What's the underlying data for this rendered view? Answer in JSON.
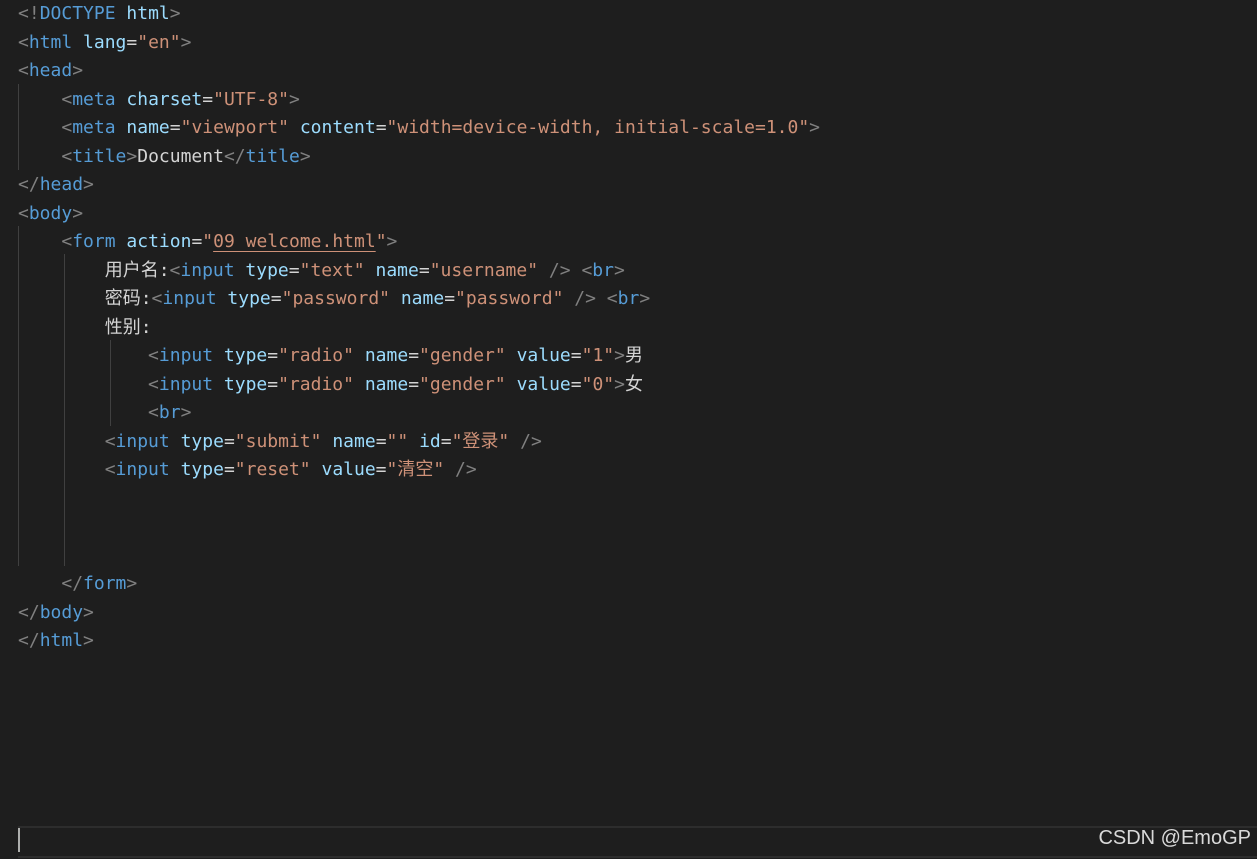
{
  "colors": {
    "background": "#1e1e1e",
    "punctuation": "#808080",
    "tag": "#569cd6",
    "attribute": "#9cdcfe",
    "string": "#ce9178",
    "text": "#d4d4d4"
  },
  "code_lines": [
    [
      [
        "punct",
        "<!"
      ],
      [
        "tag",
        "DOCTYPE"
      ],
      [
        "text",
        " "
      ],
      [
        "attr",
        "html"
      ],
      [
        "punct",
        ">"
      ]
    ],
    [
      [
        "punct",
        "<"
      ],
      [
        "tag",
        "html"
      ],
      [
        "text",
        " "
      ],
      [
        "attr",
        "lang"
      ],
      [
        "text",
        "="
      ],
      [
        "str",
        "\"en\""
      ],
      [
        "punct",
        ">"
      ]
    ],
    [
      [
        "punct",
        "<"
      ],
      [
        "tag",
        "head"
      ],
      [
        "punct",
        ">"
      ]
    ],
    [
      [
        "text",
        "    "
      ],
      [
        "punct",
        "<"
      ],
      [
        "tag",
        "meta"
      ],
      [
        "text",
        " "
      ],
      [
        "attr",
        "charset"
      ],
      [
        "text",
        "="
      ],
      [
        "str",
        "\"UTF-8\""
      ],
      [
        "punct",
        ">"
      ]
    ],
    [
      [
        "text",
        "    "
      ],
      [
        "punct",
        "<"
      ],
      [
        "tag",
        "meta"
      ],
      [
        "text",
        " "
      ],
      [
        "attr",
        "name"
      ],
      [
        "text",
        "="
      ],
      [
        "str",
        "\"viewport\""
      ],
      [
        "text",
        " "
      ],
      [
        "attr",
        "content"
      ],
      [
        "text",
        "="
      ],
      [
        "str",
        "\"width=device-width, initial-scale=1.0\""
      ],
      [
        "punct",
        ">"
      ]
    ],
    [
      [
        "text",
        "    "
      ],
      [
        "punct",
        "<"
      ],
      [
        "tag",
        "title"
      ],
      [
        "punct",
        ">"
      ],
      [
        "text",
        "Document"
      ],
      [
        "punct",
        "</"
      ],
      [
        "tag",
        "title"
      ],
      [
        "punct",
        ">"
      ]
    ],
    [
      [
        "punct",
        "</"
      ],
      [
        "tag",
        "head"
      ],
      [
        "punct",
        ">"
      ]
    ],
    [
      [
        "punct",
        "<"
      ],
      [
        "tag",
        "body"
      ],
      [
        "punct",
        ">"
      ]
    ],
    [
      [
        "text",
        "    "
      ],
      [
        "punct",
        "<"
      ],
      [
        "tag",
        "form"
      ],
      [
        "text",
        " "
      ],
      [
        "attr",
        "action"
      ],
      [
        "text",
        "="
      ],
      [
        "str",
        "\""
      ],
      [
        "link",
        "09 welcome.html"
      ],
      [
        "str",
        "\""
      ],
      [
        "punct",
        ">"
      ]
    ],
    [
      [
        "text",
        "        用户名:"
      ],
      [
        "punct",
        "<"
      ],
      [
        "tag",
        "input"
      ],
      [
        "text",
        " "
      ],
      [
        "attr",
        "type"
      ],
      [
        "text",
        "="
      ],
      [
        "str",
        "\"text\""
      ],
      [
        "text",
        " "
      ],
      [
        "attr",
        "name"
      ],
      [
        "text",
        "="
      ],
      [
        "str",
        "\"username\""
      ],
      [
        "text",
        " "
      ],
      [
        "punct",
        "/>"
      ],
      [
        "text",
        " "
      ],
      [
        "punct",
        "<"
      ],
      [
        "tag",
        "br"
      ],
      [
        "punct",
        ">"
      ]
    ],
    [
      [
        "text",
        "        密码:"
      ],
      [
        "punct",
        "<"
      ],
      [
        "tag",
        "input"
      ],
      [
        "text",
        " "
      ],
      [
        "attr",
        "type"
      ],
      [
        "text",
        "="
      ],
      [
        "str",
        "\"password\""
      ],
      [
        "text",
        " "
      ],
      [
        "attr",
        "name"
      ],
      [
        "text",
        "="
      ],
      [
        "str",
        "\"password\""
      ],
      [
        "text",
        " "
      ],
      [
        "punct",
        "/>"
      ],
      [
        "text",
        " "
      ],
      [
        "punct",
        "<"
      ],
      [
        "tag",
        "br"
      ],
      [
        "punct",
        ">"
      ]
    ],
    [
      [
        "text",
        "        性别:"
      ]
    ],
    [
      [
        "text",
        "            "
      ],
      [
        "punct",
        "<"
      ],
      [
        "tag",
        "input"
      ],
      [
        "text",
        " "
      ],
      [
        "attr",
        "type"
      ],
      [
        "text",
        "="
      ],
      [
        "str",
        "\"radio\""
      ],
      [
        "text",
        " "
      ],
      [
        "attr",
        "name"
      ],
      [
        "text",
        "="
      ],
      [
        "str",
        "\"gender\""
      ],
      [
        "text",
        " "
      ],
      [
        "attr",
        "value"
      ],
      [
        "text",
        "="
      ],
      [
        "str",
        "\"1\""
      ],
      [
        "punct",
        ">"
      ],
      [
        "text",
        "男"
      ]
    ],
    [
      [
        "text",
        "            "
      ],
      [
        "punct",
        "<"
      ],
      [
        "tag",
        "input"
      ],
      [
        "text",
        " "
      ],
      [
        "attr",
        "type"
      ],
      [
        "text",
        "="
      ],
      [
        "str",
        "\"radio\""
      ],
      [
        "text",
        " "
      ],
      [
        "attr",
        "name"
      ],
      [
        "text",
        "="
      ],
      [
        "str",
        "\"gender\""
      ],
      [
        "text",
        " "
      ],
      [
        "attr",
        "value"
      ],
      [
        "text",
        "="
      ],
      [
        "str",
        "\"0\""
      ],
      [
        "punct",
        ">"
      ],
      [
        "text",
        "女"
      ]
    ],
    [
      [
        "text",
        "            "
      ],
      [
        "punct",
        "<"
      ],
      [
        "tag",
        "br"
      ],
      [
        "punct",
        ">"
      ]
    ],
    [
      [
        "text",
        "        "
      ],
      [
        "punct",
        "<"
      ],
      [
        "tag",
        "input"
      ],
      [
        "text",
        " "
      ],
      [
        "attr",
        "type"
      ],
      [
        "text",
        "="
      ],
      [
        "str",
        "\"submit\""
      ],
      [
        "text",
        " "
      ],
      [
        "attr",
        "name"
      ],
      [
        "text",
        "="
      ],
      [
        "str",
        "\"\""
      ],
      [
        "text",
        " "
      ],
      [
        "attr",
        "id"
      ],
      [
        "text",
        "="
      ],
      [
        "str",
        "\"登录\""
      ],
      [
        "text",
        " "
      ],
      [
        "punct",
        "/>"
      ]
    ],
    [
      [
        "text",
        "        "
      ],
      [
        "punct",
        "<"
      ],
      [
        "tag",
        "input"
      ],
      [
        "text",
        " "
      ],
      [
        "attr",
        "type"
      ],
      [
        "text",
        "="
      ],
      [
        "str",
        "\"reset\""
      ],
      [
        "text",
        " "
      ],
      [
        "attr",
        "value"
      ],
      [
        "text",
        "="
      ],
      [
        "str",
        "\"清空\""
      ],
      [
        "text",
        " "
      ],
      [
        "punct",
        "/>"
      ]
    ],
    [],
    [],
    [],
    [
      [
        "text",
        "    "
      ],
      [
        "punct",
        "</"
      ],
      [
        "tag",
        "form"
      ],
      [
        "punct",
        ">"
      ]
    ],
    [
      [
        "punct",
        "</"
      ],
      [
        "tag",
        "body"
      ],
      [
        "punct",
        ">"
      ]
    ],
    [
      [
        "punct",
        "</"
      ],
      [
        "tag",
        "html"
      ],
      [
        "punct",
        ">"
      ]
    ]
  ],
  "watermark": "CSDN @EmoGP"
}
